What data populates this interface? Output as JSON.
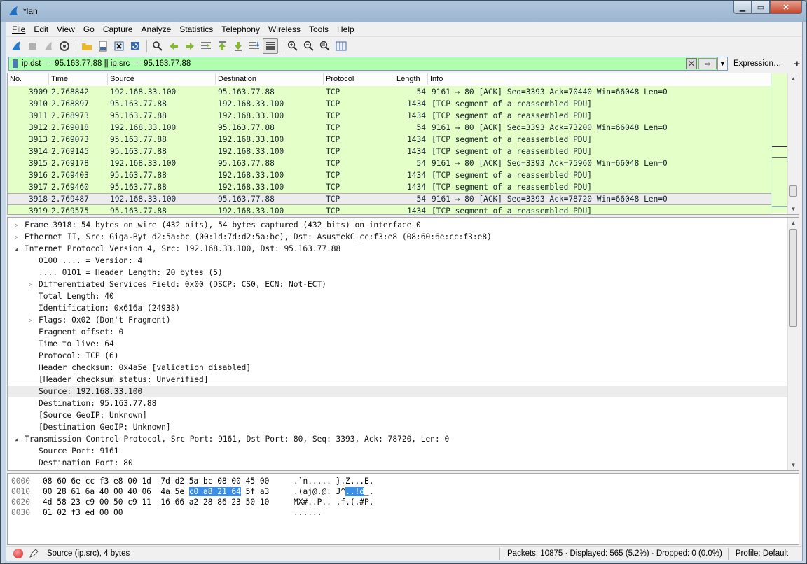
{
  "window": {
    "title": "*lan"
  },
  "menu": [
    "File",
    "Edit",
    "View",
    "Go",
    "Capture",
    "Analyze",
    "Statistics",
    "Telephony",
    "Wireless",
    "Tools",
    "Help"
  ],
  "filter": {
    "value": "ip.dst == 95.163.77.88 || ip.src == 95.163.77.88",
    "expression_label": "Expression…",
    "add_label": "+"
  },
  "packet_list": {
    "columns": [
      "No.",
      "Time",
      "Source",
      "Destination",
      "Protocol",
      "Length",
      "Info"
    ],
    "rows": [
      {
        "no": "3909",
        "time": "2.768842",
        "src": "192.168.33.100",
        "dst": "95.163.77.88",
        "proto": "TCP",
        "len": "54",
        "info": "9161 → 80 [ACK] Seq=3393 Ack=70440 Win=66048 Len=0"
      },
      {
        "no": "3910",
        "time": "2.768897",
        "src": "95.163.77.88",
        "dst": "192.168.33.100",
        "proto": "TCP",
        "len": "1434",
        "info": "[TCP segment of a reassembled PDU]"
      },
      {
        "no": "3911",
        "time": "2.768973",
        "src": "95.163.77.88",
        "dst": "192.168.33.100",
        "proto": "TCP",
        "len": "1434",
        "info": "[TCP segment of a reassembled PDU]"
      },
      {
        "no": "3912",
        "time": "2.769018",
        "src": "192.168.33.100",
        "dst": "95.163.77.88",
        "proto": "TCP",
        "len": "54",
        "info": "9161 → 80 [ACK] Seq=3393 Ack=73200 Win=66048 Len=0"
      },
      {
        "no": "3913",
        "time": "2.769073",
        "src": "95.163.77.88",
        "dst": "192.168.33.100",
        "proto": "TCP",
        "len": "1434",
        "info": "[TCP segment of a reassembled PDU]"
      },
      {
        "no": "3914",
        "time": "2.769145",
        "src": "95.163.77.88",
        "dst": "192.168.33.100",
        "proto": "TCP",
        "len": "1434",
        "info": "[TCP segment of a reassembled PDU]"
      },
      {
        "no": "3915",
        "time": "2.769178",
        "src": "192.168.33.100",
        "dst": "95.163.77.88",
        "proto": "TCP",
        "len": "54",
        "info": "9161 → 80 [ACK] Seq=3393 Ack=75960 Win=66048 Len=0"
      },
      {
        "no": "3916",
        "time": "2.769403",
        "src": "95.163.77.88",
        "dst": "192.168.33.100",
        "proto": "TCP",
        "len": "1434",
        "info": "[TCP segment of a reassembled PDU]"
      },
      {
        "no": "3917",
        "time": "2.769460",
        "src": "95.163.77.88",
        "dst": "192.168.33.100",
        "proto": "TCP",
        "len": "1434",
        "info": "[TCP segment of a reassembled PDU]"
      },
      {
        "no": "3918",
        "time": "2.769487",
        "src": "192.168.33.100",
        "dst": "95.163.77.88",
        "proto": "TCP",
        "len": "54",
        "info": "9161 → 80 [ACK] Seq=3393 Ack=78720 Win=66048 Len=0",
        "selected": true
      },
      {
        "no": "3919",
        "time": "2.769575",
        "src": "95.163.77.88",
        "dst": "192.168.33.100",
        "proto": "TCP",
        "len": "1434",
        "info": "[TCP segment of a reassembled PDU]"
      }
    ]
  },
  "details": [
    {
      "text": "Frame 3918: 54 bytes on wire (432 bits), 54 bytes captured (432 bits) on interface 0",
      "level": 0,
      "expander": "collapsed"
    },
    {
      "text": "Ethernet II, Src: Giga-Byt_d2:5a:bc (00:1d:7d:d2:5a:bc), Dst: AsustekC_cc:f3:e8 (08:60:6e:cc:f3:e8)",
      "level": 0,
      "expander": "collapsed"
    },
    {
      "text": "Internet Protocol Version 4, Src: 192.168.33.100, Dst: 95.163.77.88",
      "level": 0,
      "expander": "expanded"
    },
    {
      "text": "0100 .... = Version: 4",
      "level": 1,
      "expander": "none"
    },
    {
      "text": ".... 0101 = Header Length: 20 bytes (5)",
      "level": 1,
      "expander": "none"
    },
    {
      "text": "Differentiated Services Field: 0x00 (DSCP: CS0, ECN: Not-ECT)",
      "level": 1,
      "expander": "collapsed"
    },
    {
      "text": "Total Length: 40",
      "level": 1,
      "expander": "none"
    },
    {
      "text": "Identification: 0x616a (24938)",
      "level": 1,
      "expander": "none"
    },
    {
      "text": "Flags: 0x02 (Don't Fragment)",
      "level": 1,
      "expander": "collapsed"
    },
    {
      "text": "Fragment offset: 0",
      "level": 1,
      "expander": "none"
    },
    {
      "text": "Time to live: 64",
      "level": 1,
      "expander": "none"
    },
    {
      "text": "Protocol: TCP (6)",
      "level": 1,
      "expander": "none"
    },
    {
      "text": "Header checksum: 0x4a5e [validation disabled]",
      "level": 1,
      "expander": "none"
    },
    {
      "text": "[Header checksum status: Unverified]",
      "level": 1,
      "expander": "none"
    },
    {
      "text": "Source: 192.168.33.100",
      "level": 1,
      "expander": "none",
      "highlighted": true
    },
    {
      "text": "Destination: 95.163.77.88",
      "level": 1,
      "expander": "none"
    },
    {
      "text": "[Source GeoIP: Unknown]",
      "level": 1,
      "expander": "none"
    },
    {
      "text": "[Destination GeoIP: Unknown]",
      "level": 1,
      "expander": "none"
    },
    {
      "text": "Transmission Control Protocol, Src Port: 9161, Dst Port: 80, Seq: 3393, Ack: 78720, Len: 0",
      "level": 0,
      "expander": "expanded"
    },
    {
      "text": "Source Port: 9161",
      "level": 1,
      "expander": "none"
    },
    {
      "text": "Destination Port: 80",
      "level": 1,
      "expander": "none"
    }
  ],
  "hex": [
    {
      "offset": "0000",
      "bytes_a": "08 60 6e cc f3 e8 00 1d  7d d2 5a bc 08 00 45 00",
      "bytes_sel": "",
      "bytes_b": "",
      "ascii_a": ".`n..... }.Z...E.",
      "ascii_sel": "",
      "ascii_b": ""
    },
    {
      "offset": "0010",
      "bytes_a": "00 28 61 6a 40 00 40 06  4a 5e ",
      "bytes_sel": "c0 a8 21 64",
      "bytes_b": " 5f a3",
      "ascii_a": ".(aj@.@. J^",
      "ascii_sel": "..!d",
      "ascii_b": "_."
    },
    {
      "offset": "0020",
      "bytes_a": "4d 58 23 c9 00 50 c9 11  16 66 a2 28 86 23 50 10",
      "bytes_sel": "",
      "bytes_b": "",
      "ascii_a": "MX#..P.. .f.(.#P.",
      "ascii_sel": "",
      "ascii_b": ""
    },
    {
      "offset": "0030",
      "bytes_a": "01 02 f3 ed 00 00",
      "bytes_sel": "",
      "bytes_b": "",
      "ascii_a": "......",
      "ascii_sel": "",
      "ascii_b": ""
    }
  ],
  "status": {
    "field": "Source (ip.src), 4 bytes",
    "packets": "Packets: 10875 · Displayed: 565 (5.2%) · Dropped: 0 (0.0%)",
    "profile": "Profile: Default"
  },
  "colors": {
    "row_bg": "#e4ffc7",
    "filter_valid": "#afffaf",
    "hex_selection": "#3b8fe8"
  }
}
